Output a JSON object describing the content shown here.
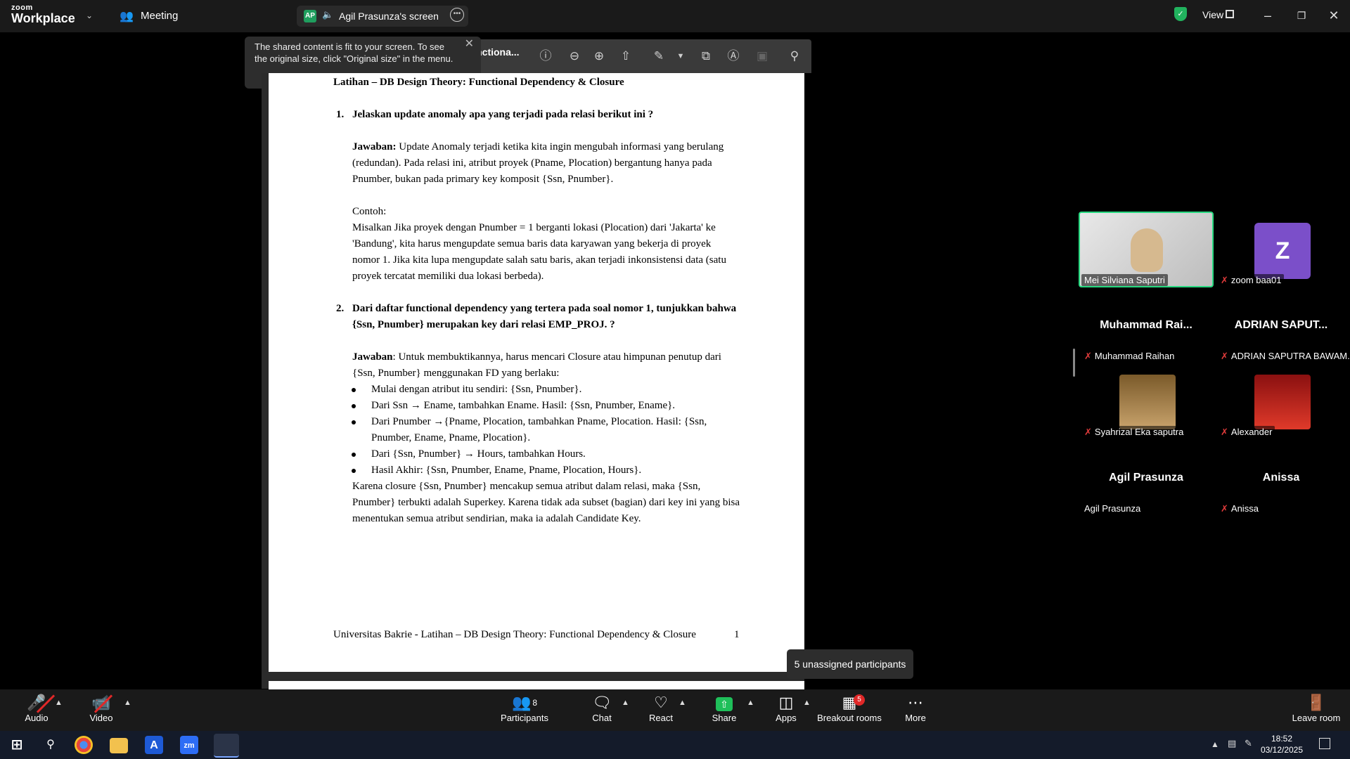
{
  "app": {
    "logo_top": "zoom",
    "logo_bottom": "Workplace",
    "meeting_label": "Meeting"
  },
  "share": {
    "badge": "AP",
    "title": "Agil Prasunza's screen"
  },
  "view": {
    "label": "View"
  },
  "tooltip": {
    "text": "The shared content is fit to your screen. To see the original size, click \"Original size\" in the menu."
  },
  "doc_toolbar": {
    "title": "Functiona..."
  },
  "document": {
    "heading": "Latihan – DB Design Theory: Functional Dependency & Closure",
    "q1_num": "1.",
    "q1": "Jelaskan update anomaly apa yang terjadi pada relasi berikut ini ?",
    "a1_label": "Jawaban:",
    "a1_text": " Update Anomaly terjadi ketika kita ingin mengubah informasi yang berulang (redundan). Pada relasi ini, atribut proyek (Pname, Plocation) bergantung hanya pada Pnumber, bukan pada primary key komposit {Ssn, Pnumber}.",
    "contoh_label": "Contoh:",
    "contoh_text": "Misalkan Jika proyek dengan Pnumber = 1 berganti lokasi (Plocation) dari 'Jakarta' ke 'Bandung', kita harus mengupdate semua baris data karyawan yang bekerja di proyek nomor 1. Jika kita lupa mengupdate salah satu baris, akan terjadi inkonsistensi data (satu proyek tercatat memiliki dua lokasi berbeda).",
    "q2_num": "2.",
    "q2": "Dari daftar functional dependency yang tertera pada soal nomor 1, tunjukkan bahwa {Ssn, Pnumber} merupakan key dari relasi EMP_PROJ. ?",
    "a2_label": "Jawaban",
    "a2_text": ": Untuk membuktikannya, harus mencari Closure atau himpunan penutup dari {Ssn, Pnumber} menggunakan FD yang berlaku:",
    "bullets": [
      "Mulai dengan atribut itu sendiri: {Ssn, Pnumber}.",
      "Dari Ssn → Ename, tambahkan Ename. Hasil: {Ssn, Pnumber, Ename}.",
      "Dari Pnumber →{Pname, Plocation, tambahkan Pname, Plocation. Hasil: {Ssn, Pnumber, Ename, Pname, Plocation}.",
      "Dari {Ssn, Pnumber} → Hours, tambahkan Hours.",
      "Hasil Akhir: {Ssn, Pnumber, Ename, Pname, Plocation, Hours}."
    ],
    "conclusion": "Karena closure {Ssn, Pnumber} mencakup semua atribut dalam relasi, maka {Ssn, Pnumber} terbukti adalah Superkey. Karena tidak ada subset (bagian) dari key ini yang bisa menentukan semua atribut sendirian, maka ia adalah Candidate Key.",
    "footer": "Universitas Bakrie - Latihan – DB Design Theory: Functional Dependency & Closure",
    "page_number": "1"
  },
  "gallery": {
    "tile1_name": "Mei Silviana Saputri",
    "tile2_name": "zoom baa01",
    "tile2_initial": "Z",
    "row2_big1": "Muhammad Rai...",
    "row2_big2": "ADRIAN SAPUT...",
    "row2_tag1": "Muhammad Raihan",
    "row2_tag2": "ADRIAN SAPUTRA BAWAM...",
    "row3_tag1": "Syahrizal Eka saputra",
    "row3_tag2": "Alexander",
    "row4_big1": "Agil Prasunza",
    "row4_big2": "Anissa",
    "row4_tag1": "Agil Prasunza",
    "row4_tag2": "Anissa"
  },
  "unassigned": {
    "text": "5 unassigned participants"
  },
  "toolbar": {
    "audio": "Audio",
    "video": "Video",
    "participants": "Participants",
    "participants_count": "8",
    "chat": "Chat",
    "react": "React",
    "share": "Share",
    "apps": "Apps",
    "breakout": "Breakout rooms",
    "breakout_badge": "5",
    "more": "More",
    "leave": "Leave room"
  },
  "taskbar": {
    "time": "18:52",
    "date": "03/12/2025",
    "zoom_icon": "zm"
  },
  "colors": {
    "share_green": "#1f9e5e",
    "leave_red": "#e02828",
    "active_border": "#27d980",
    "avatar_purple": "#7b4fc9"
  }
}
